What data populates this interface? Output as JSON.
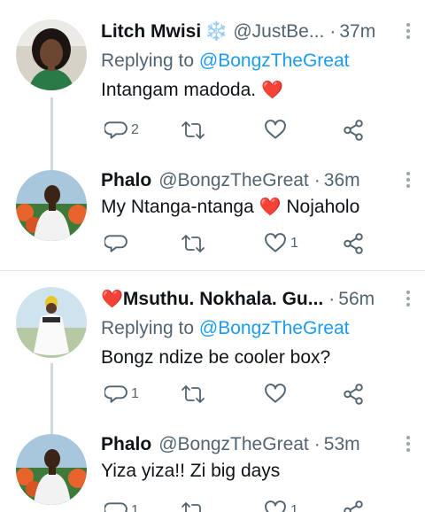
{
  "tweets": [
    {
      "name": "Litch Mwisi",
      "name_emoji": "❄️",
      "handle": "@JustBe...",
      "time": "37m",
      "replying_prefix": "Replying to",
      "replying_to": "@BongzTheGreat",
      "text": "Intangam madoda.",
      "text_emoji": "❤️",
      "counts": {
        "reply": "2",
        "retweet": "",
        "like": ""
      }
    },
    {
      "name": "Phalo",
      "handle": "@BongzTheGreat",
      "time": "36m",
      "text_before": "My Ntanga-ntanga",
      "text_emoji": "❤️",
      "text_after": "Nojaholo",
      "counts": {
        "reply": "",
        "retweet": "",
        "like": "1"
      }
    },
    {
      "name_emoji": "❤️",
      "name": "Msuthu. Nokhala. Gu...",
      "time": "56m",
      "replying_prefix": "Replying to",
      "replying_to": "@BongzTheGreat",
      "text": "Bongz ndize be cooler box?",
      "counts": {
        "reply": "1",
        "retweet": "",
        "like": ""
      }
    },
    {
      "name": "Phalo",
      "handle": "@BongzTheGreat",
      "time": "53m",
      "text": "Yiza yiza!! Zi big days",
      "counts": {
        "reply": "1",
        "retweet": "",
        "like": "1"
      }
    }
  ],
  "colors": {
    "accent": "#1d9bf0",
    "secondary_text": "#536471",
    "heart": "#e0245e"
  },
  "icons": [
    "reply-icon",
    "retweet-icon",
    "like-icon",
    "share-icon",
    "more-options-icon"
  ]
}
